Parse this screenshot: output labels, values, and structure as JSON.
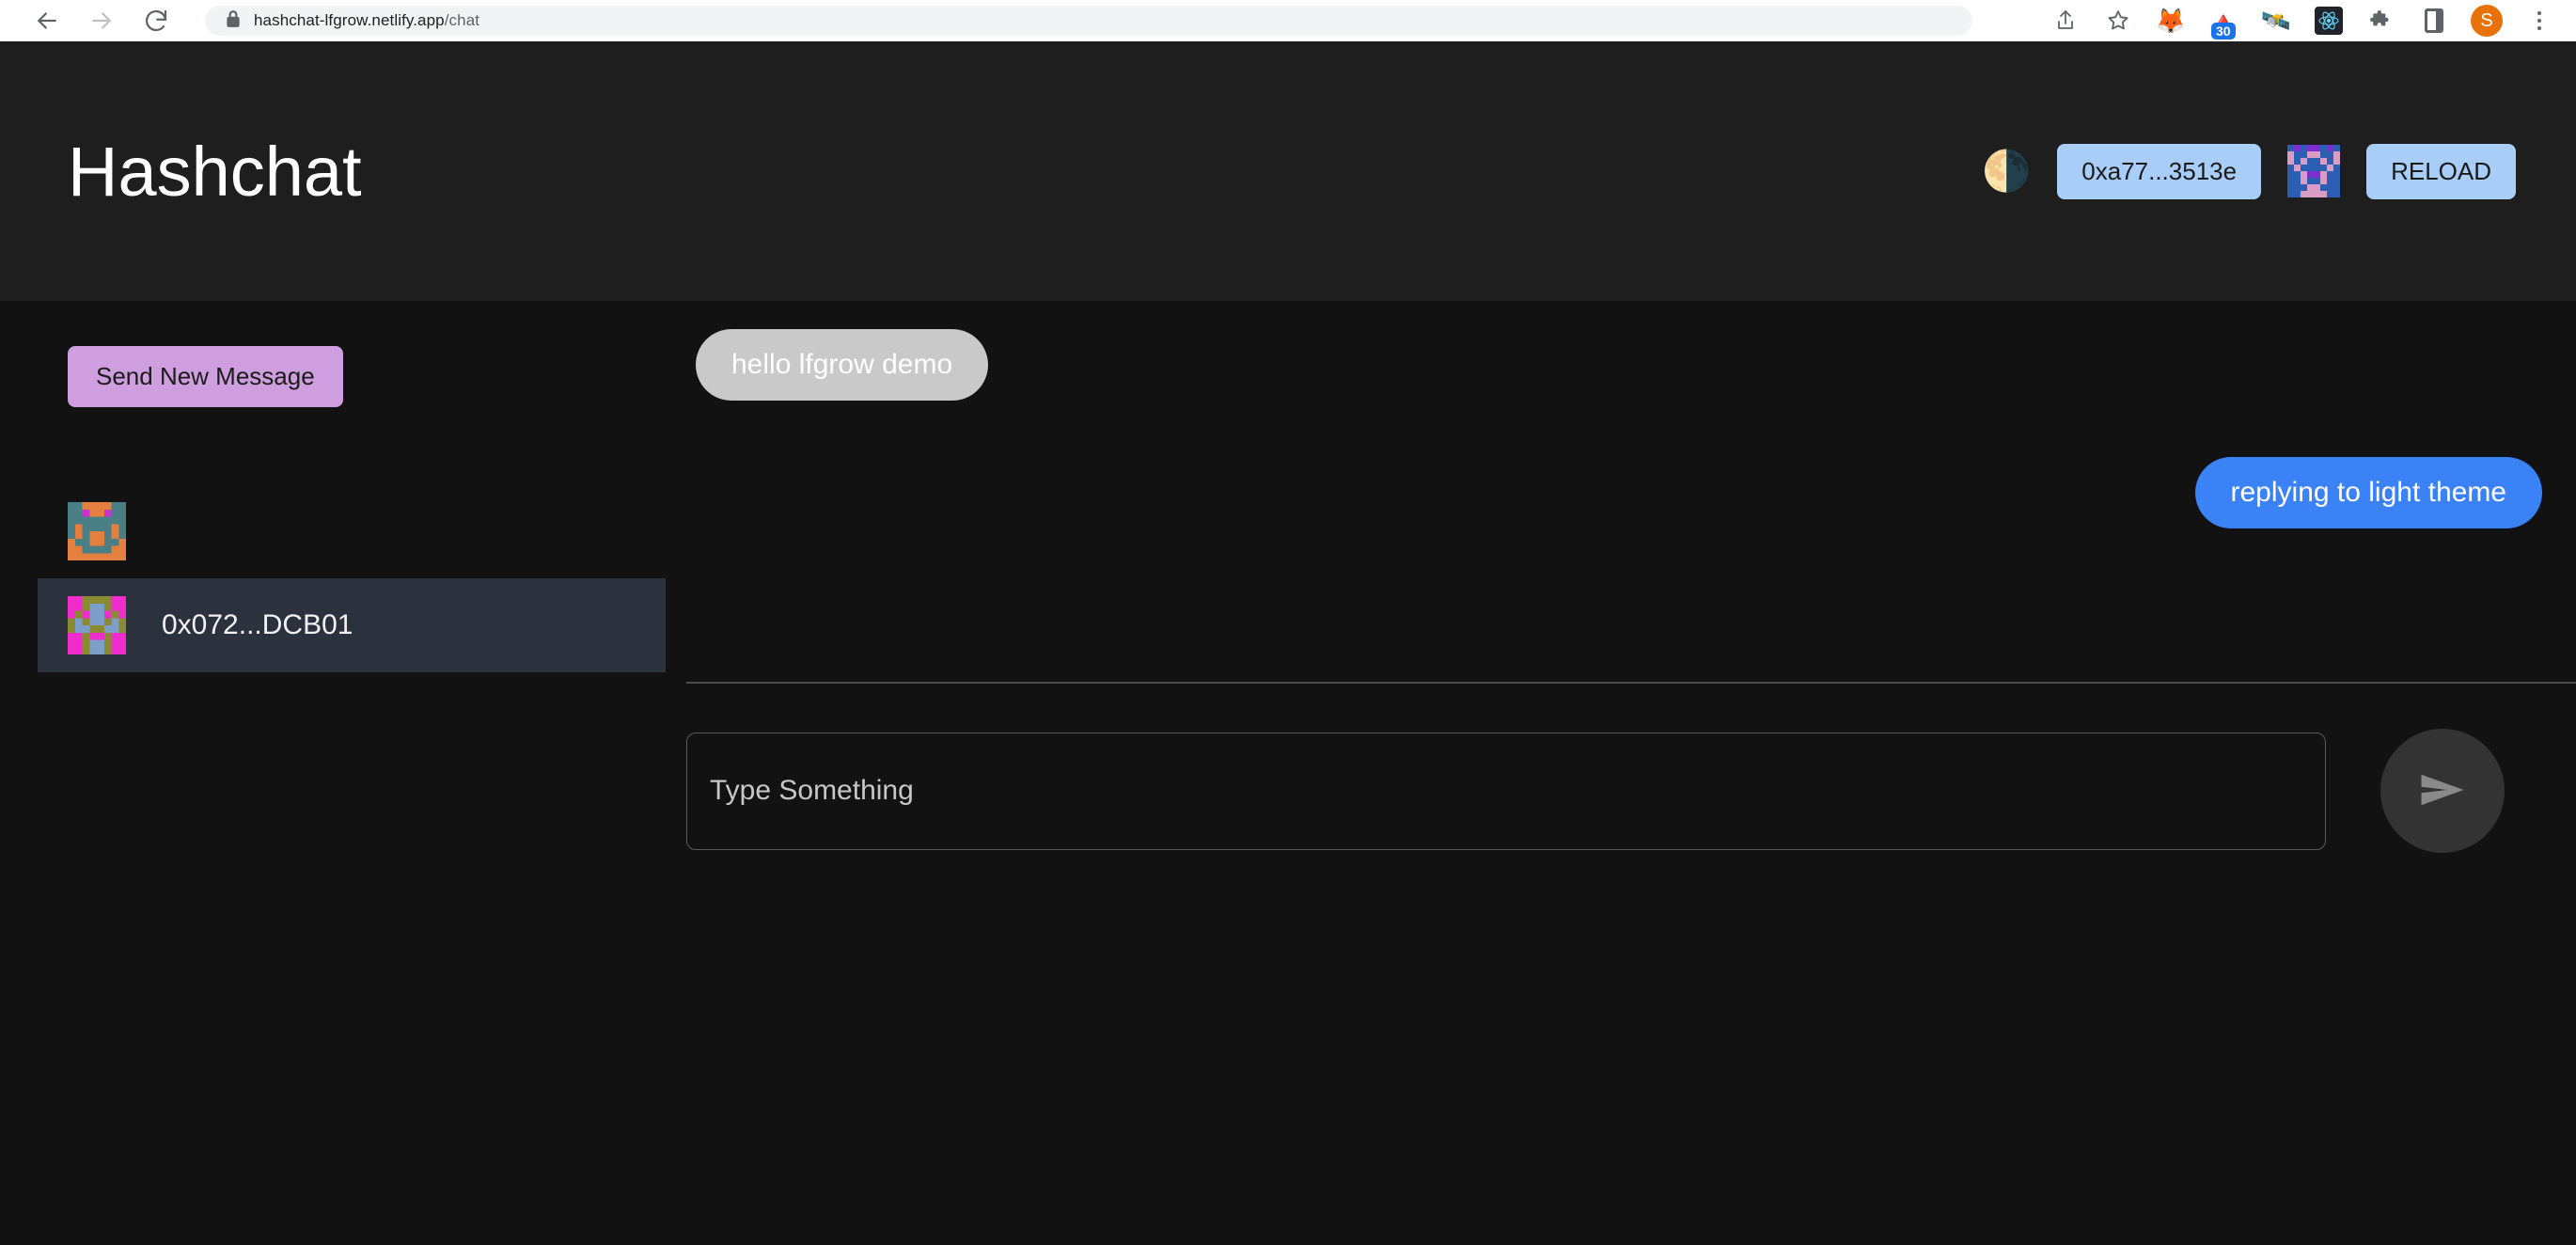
{
  "browser": {
    "back_icon": "back-arrow-icon",
    "forward_icon": "forward-arrow-icon",
    "reload_icon": "reload-icon",
    "lock_icon": "lock-icon",
    "url_host": "hashchat-lfgrow.netlify.app",
    "url_path": "/chat",
    "toolbar_icons": [
      {
        "name": "share-icon",
        "glyph": "share"
      },
      {
        "name": "bookmark-star-icon",
        "glyph": "star"
      },
      {
        "name": "metamask-extension-icon",
        "glyph": "🦊"
      },
      {
        "name": "pyramid-extension-icon",
        "glyph": "🔺",
        "badge": "30"
      },
      {
        "name": "satellite-extension-icon",
        "glyph": "🛰"
      },
      {
        "name": "react-devtools-icon",
        "glyph": "react"
      },
      {
        "name": "extensions-puzzle-icon",
        "glyph": "puzzle"
      },
      {
        "name": "side-panel-icon",
        "glyph": "panel"
      },
      {
        "name": "profile-avatar",
        "glyph": "S"
      },
      {
        "name": "chrome-menu-icon",
        "glyph": "dots"
      }
    ]
  },
  "header": {
    "title": "Hashchat",
    "theme_toggle_glyph": "🌗",
    "account_address": "0xa77...3513e",
    "reload_label": "RELOAD"
  },
  "sidebar": {
    "new_message_label": "Send New Message",
    "conversations": [
      {
        "label": "",
        "selected": false,
        "avatar": "identicon-orange-teal"
      },
      {
        "label": "0x072...DCB01",
        "selected": true,
        "avatar": "identicon-magenta-olive"
      }
    ]
  },
  "chat": {
    "messages": [
      {
        "text": "hello lfgrow demo",
        "direction": "incoming"
      },
      {
        "text": "replying to light theme",
        "direction": "outgoing"
      }
    ],
    "input_placeholder": "Type Something",
    "input_value": "",
    "send_icon": "send-paper-plane-icon"
  },
  "colors": {
    "page_background": "#121212",
    "header_background": "#1e1e1e",
    "accent_purple": "#cf9ede",
    "accent_blue_button": "#a8cdf7",
    "outgoing_bubble": "#3b82f6",
    "incoming_bubble": "#c9c9c9",
    "selected_row": "#2b323e"
  }
}
